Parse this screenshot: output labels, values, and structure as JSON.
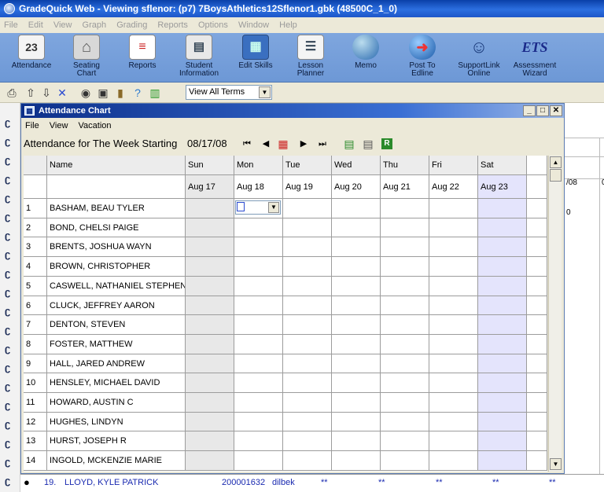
{
  "app": {
    "title": "GradeQuick Web - Viewing sflenor: (p7) 7BoysAthletics12Sflenor1.gbk (48500C_1_0)",
    "menu": [
      "File",
      "Edit",
      "View",
      "Graph",
      "Grading",
      "Reports",
      "Options",
      "Window",
      "Help"
    ]
  },
  "toolbar": {
    "buttons": [
      {
        "label": "Attendance",
        "icon": "calendar-icon"
      },
      {
        "label": "Seating\nChart",
        "icon": "desk-icon"
      },
      {
        "label": "Reports",
        "icon": "report-icon"
      },
      {
        "label": "Student\nInformation",
        "icon": "id-card-icon"
      },
      {
        "label": "Edit Skills",
        "icon": "blocks-icon"
      },
      {
        "label": "Lesson\nPlanner",
        "icon": "planner-icon"
      },
      {
        "label": "Memo",
        "icon": "memo-icon"
      },
      {
        "label": "Post To\nEdline",
        "icon": "globe-icon"
      },
      {
        "label": "SupportLink\nOnline",
        "icon": "support-icon"
      },
      {
        "label": "Assessment\nWizard",
        "icon": "ets-icon"
      }
    ],
    "ets_text": "ETS",
    "term_select": "View All Terms"
  },
  "chart_window": {
    "title": "Attendance Chart",
    "menu": [
      "File",
      "View",
      "Vacation"
    ],
    "week_label": "Attendance for The Week Starting",
    "week_date": "08/17/08",
    "columns": {
      "name": "Name",
      "days": [
        "Sun",
        "Mon",
        "Tue",
        "Wed",
        "Thu",
        "Fri",
        "Sat"
      ],
      "dates": [
        "Aug 17",
        "Aug 18",
        "Aug 19",
        "Aug 20",
        "Aug 21",
        "Aug 22",
        "Aug 23"
      ]
    },
    "students": [
      {
        "num": "1",
        "name": "BASHAM, BEAU TYLER"
      },
      {
        "num": "2",
        "name": "BOND, CHELSI PAIGE"
      },
      {
        "num": "3",
        "name": "BRENTS, JOSHUA WAYN"
      },
      {
        "num": "4",
        "name": "BROWN, CHRISTOPHER"
      },
      {
        "num": "5",
        "name": "CASWELL, NATHANIEL STEPHEN"
      },
      {
        "num": "6",
        "name": "CLUCK, JEFFREY AARON"
      },
      {
        "num": "7",
        "name": "DENTON, STEVEN"
      },
      {
        "num": "8",
        "name": "FOSTER, MATTHEW"
      },
      {
        "num": "9",
        "name": "HALL, JARED ANDREW"
      },
      {
        "num": "10",
        "name": "HENSLEY, MICHAEL DAVID"
      },
      {
        "num": "11",
        "name": "HOWARD, AUSTIN C"
      },
      {
        "num": "12",
        "name": "HUGHES, LINDYN"
      },
      {
        "num": "13",
        "name": "HURST, JOSEPH R"
      },
      {
        "num": "14",
        "name": "INGOLD, MCKENZIE MARIE"
      }
    ]
  },
  "background": {
    "right_header": "/08",
    "right_header2": "0",
    "right_zero": "0",
    "bottom_row": {
      "num": "19.",
      "name": "LLOYD, KYLE PATRICK",
      "id": "200001632",
      "user": "dilbek",
      "marks": [
        "**",
        "**",
        "**",
        "**",
        "**"
      ]
    }
  }
}
